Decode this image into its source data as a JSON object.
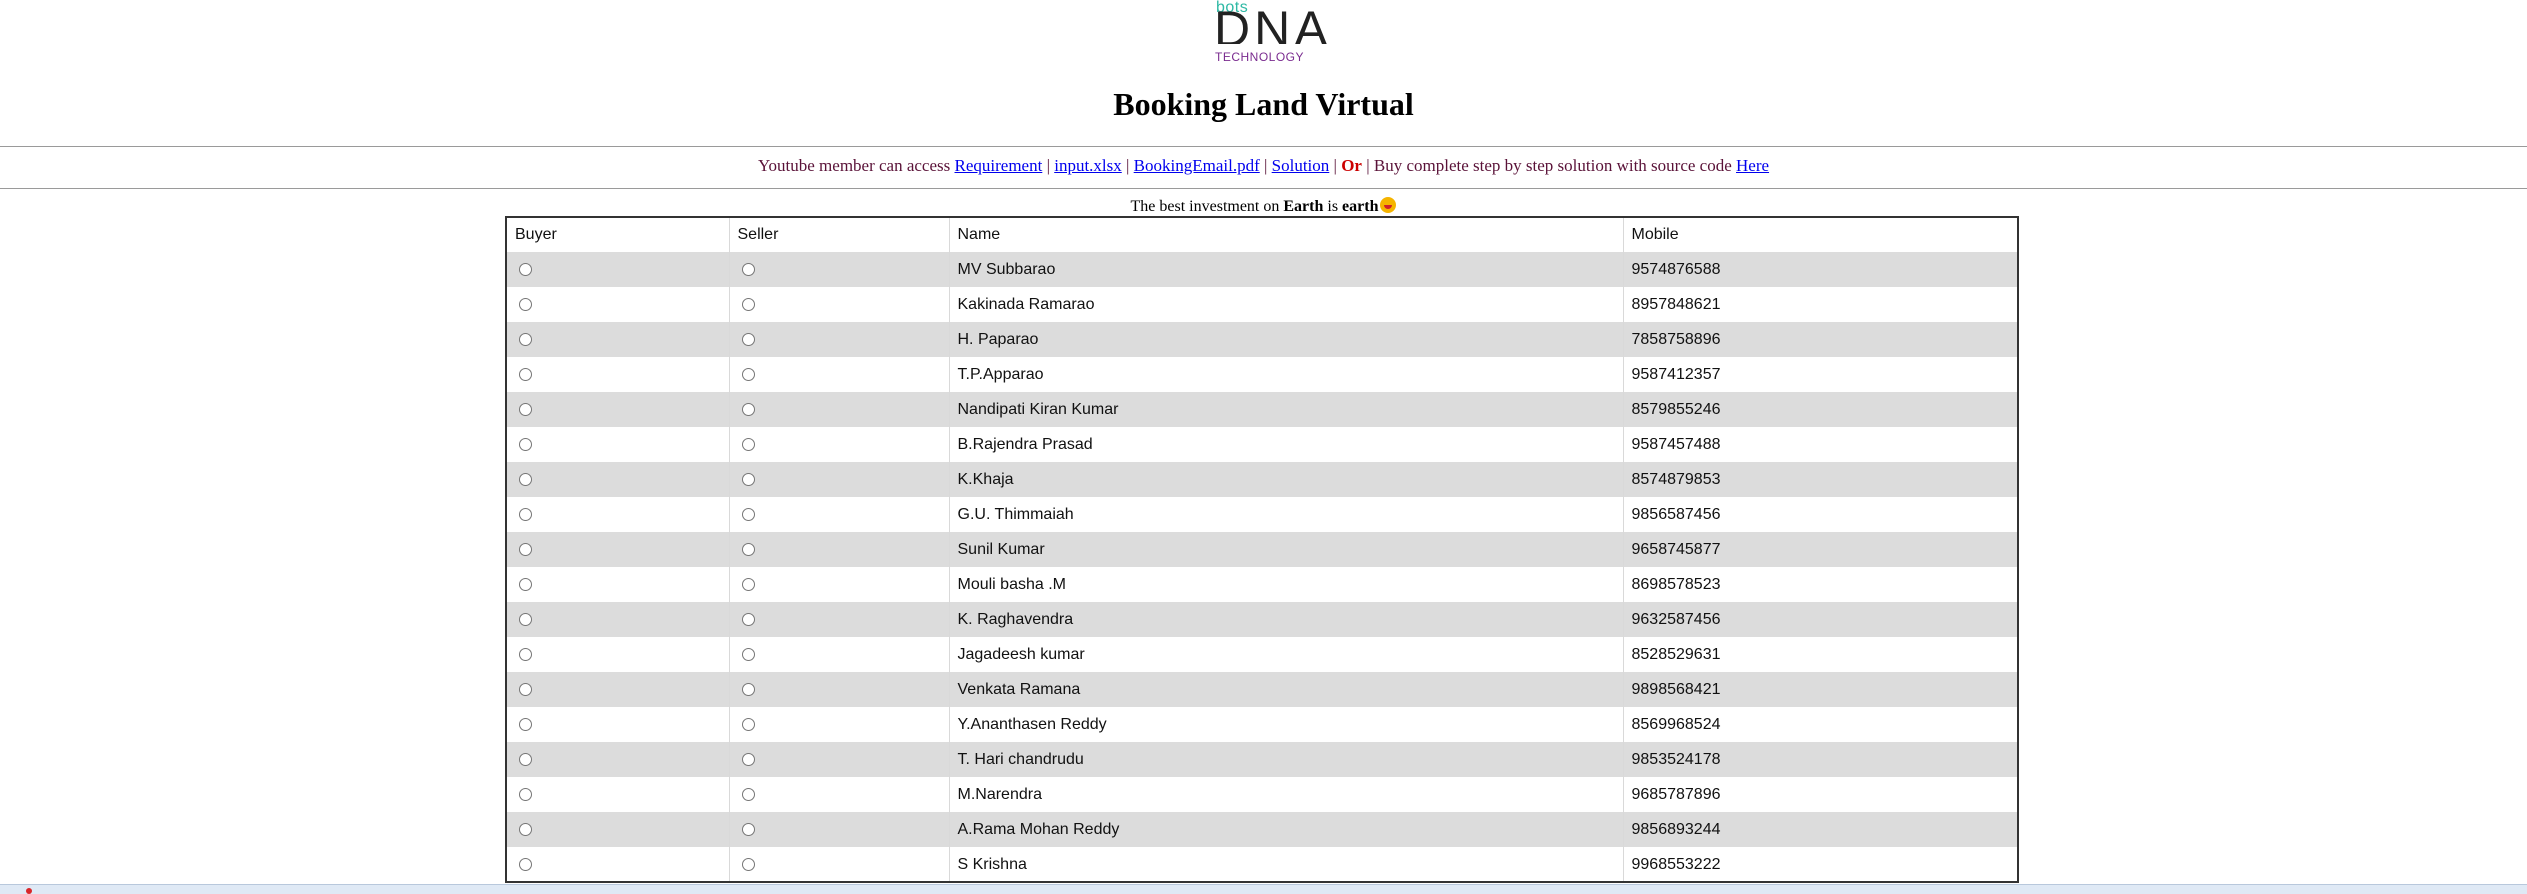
{
  "logo": {
    "top": "bots",
    "main": "DNA",
    "sub": "TECHNOLOGY"
  },
  "page_title": "Booking Land Virtual",
  "links_bar": {
    "intro": "Youtube member can access",
    "requirement": "Requirement",
    "input_xlsx": "input.xlsx",
    "booking_pdf": "BookingEmail.pdf",
    "solution": "Solution",
    "or": "Or",
    "buy_text": "Buy complete step by step solution with source code",
    "here": "Here",
    "separator": "|"
  },
  "tagline": {
    "part1": "The best investment on",
    "earth_bold": "Earth",
    "is": "is",
    "earth_lower": "earth"
  },
  "table": {
    "headers": {
      "buyer": "Buyer",
      "seller": "Seller",
      "name": "Name",
      "mobile": "Mobile"
    },
    "rows": [
      {
        "name": "MV Subbarao",
        "mobile": "9574876588"
      },
      {
        "name": "Kakinada Ramarao",
        "mobile": "8957848621"
      },
      {
        "name": "H. Paparao",
        "mobile": "7858758896"
      },
      {
        "name": "T.P.Apparao",
        "mobile": "9587412357"
      },
      {
        "name": "Nandipati Kiran Kumar",
        "mobile": "8579855246"
      },
      {
        "name": "B.Rajendra Prasad",
        "mobile": "9587457488"
      },
      {
        "name": "K.Khaja",
        "mobile": "8574879853"
      },
      {
        "name": "G.U. Thimmaiah",
        "mobile": "9856587456"
      },
      {
        "name": "Sunil Kumar",
        "mobile": "9658745877"
      },
      {
        "name": "Mouli basha .M",
        "mobile": "8698578523"
      },
      {
        "name": "K. Raghavendra",
        "mobile": "9632587456"
      },
      {
        "name": "Jagadeesh kumar",
        "mobile": "8528529631"
      },
      {
        "name": "Venkata Ramana",
        "mobile": "9898568421"
      },
      {
        "name": "Y.Ananthasen Reddy",
        "mobile": "8569968524"
      },
      {
        "name": "T. Hari chandrudu",
        "mobile": "9853524178"
      },
      {
        "name": "M.Narendra",
        "mobile": "9685787896"
      },
      {
        "name": "A.Rama Mohan Reddy",
        "mobile": "9856893244"
      },
      {
        "name": "S Krishna",
        "mobile": "9968553222"
      }
    ]
  }
}
